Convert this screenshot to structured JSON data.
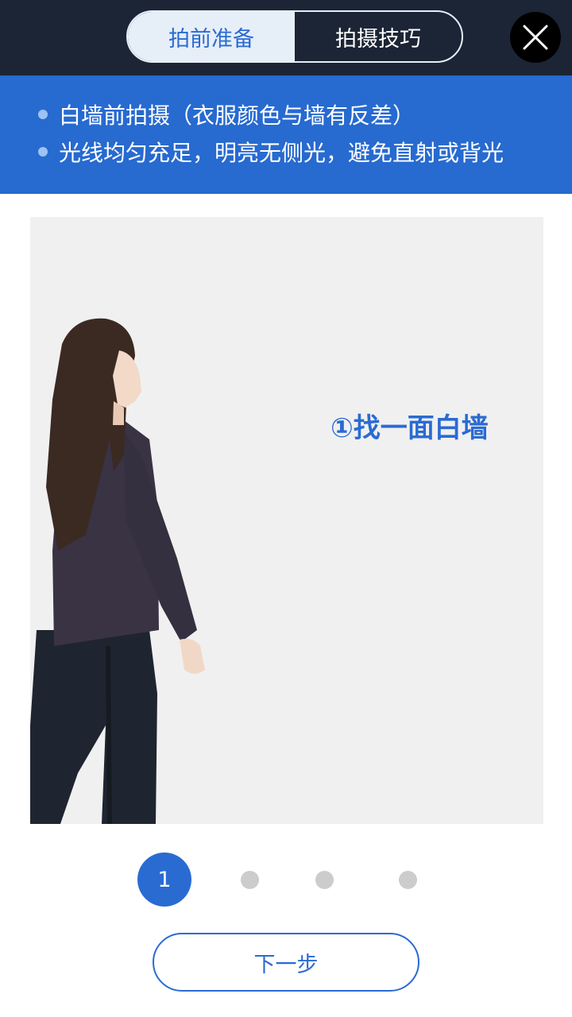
{
  "header": {
    "tabs": [
      "拍前准备",
      "拍摄技巧"
    ],
    "active_tab": 0,
    "close_icon": "close-icon"
  },
  "tips": [
    "白墙前拍摄（衣服颜色与墙有反差）",
    "光线均匀充足，明亮无侧光，避免直射或背光"
  ],
  "scene": {
    "caption": "①找一面白墙",
    "image": "woman-walking-photo"
  },
  "pager": {
    "current_label": "1",
    "total": 4,
    "current": 1
  },
  "next_button": "下一步",
  "colors": {
    "accent": "#2a6bd2",
    "topbar": "#1c2535",
    "banner": "#276ad0",
    "scene_bg": "#f0f0f0"
  }
}
